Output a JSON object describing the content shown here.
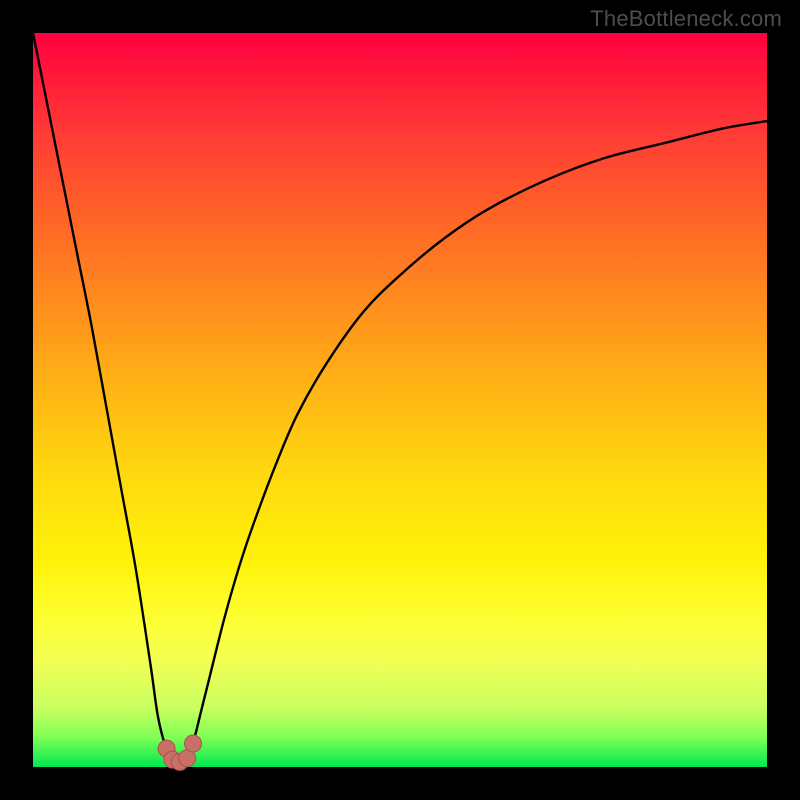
{
  "watermark": "TheBottleneck.com",
  "colors": {
    "frame": "#000000",
    "watermark": "#4d4d4d",
    "curve": "#000000",
    "marker_fill": "#c86f66",
    "marker_stroke": "#a8544d"
  },
  "chart_data": {
    "type": "line",
    "title": "",
    "xlabel": "",
    "ylabel": "",
    "xlim": [
      0,
      100
    ],
    "ylim": [
      0,
      100
    ],
    "grid": false,
    "series": [
      {
        "name": "left-branch",
        "x": [
          0,
          2,
          4,
          6,
          8,
          10,
          12,
          14,
          16,
          17,
          18,
          19
        ],
        "y": [
          100,
          90,
          80,
          70,
          60,
          49,
          38,
          27,
          14,
          7,
          3,
          1
        ]
      },
      {
        "name": "right-branch",
        "x": [
          21,
          22,
          23,
          24,
          26,
          28,
          30,
          33,
          36,
          40,
          45,
          50,
          56,
          62,
          70,
          78,
          86,
          94,
          100
        ],
        "y": [
          1,
          4,
          8,
          12,
          20,
          27,
          33,
          41,
          48,
          55,
          62,
          67,
          72,
          76,
          80,
          83,
          85,
          87,
          88
        ]
      }
    ],
    "markers": [
      {
        "x": 18.2,
        "y": 2.5
      },
      {
        "x": 19.0,
        "y": 1.0
      },
      {
        "x": 20.0,
        "y": 0.7
      },
      {
        "x": 21.0,
        "y": 1.2
      },
      {
        "x": 21.8,
        "y": 3.2
      }
    ],
    "annotations": []
  }
}
